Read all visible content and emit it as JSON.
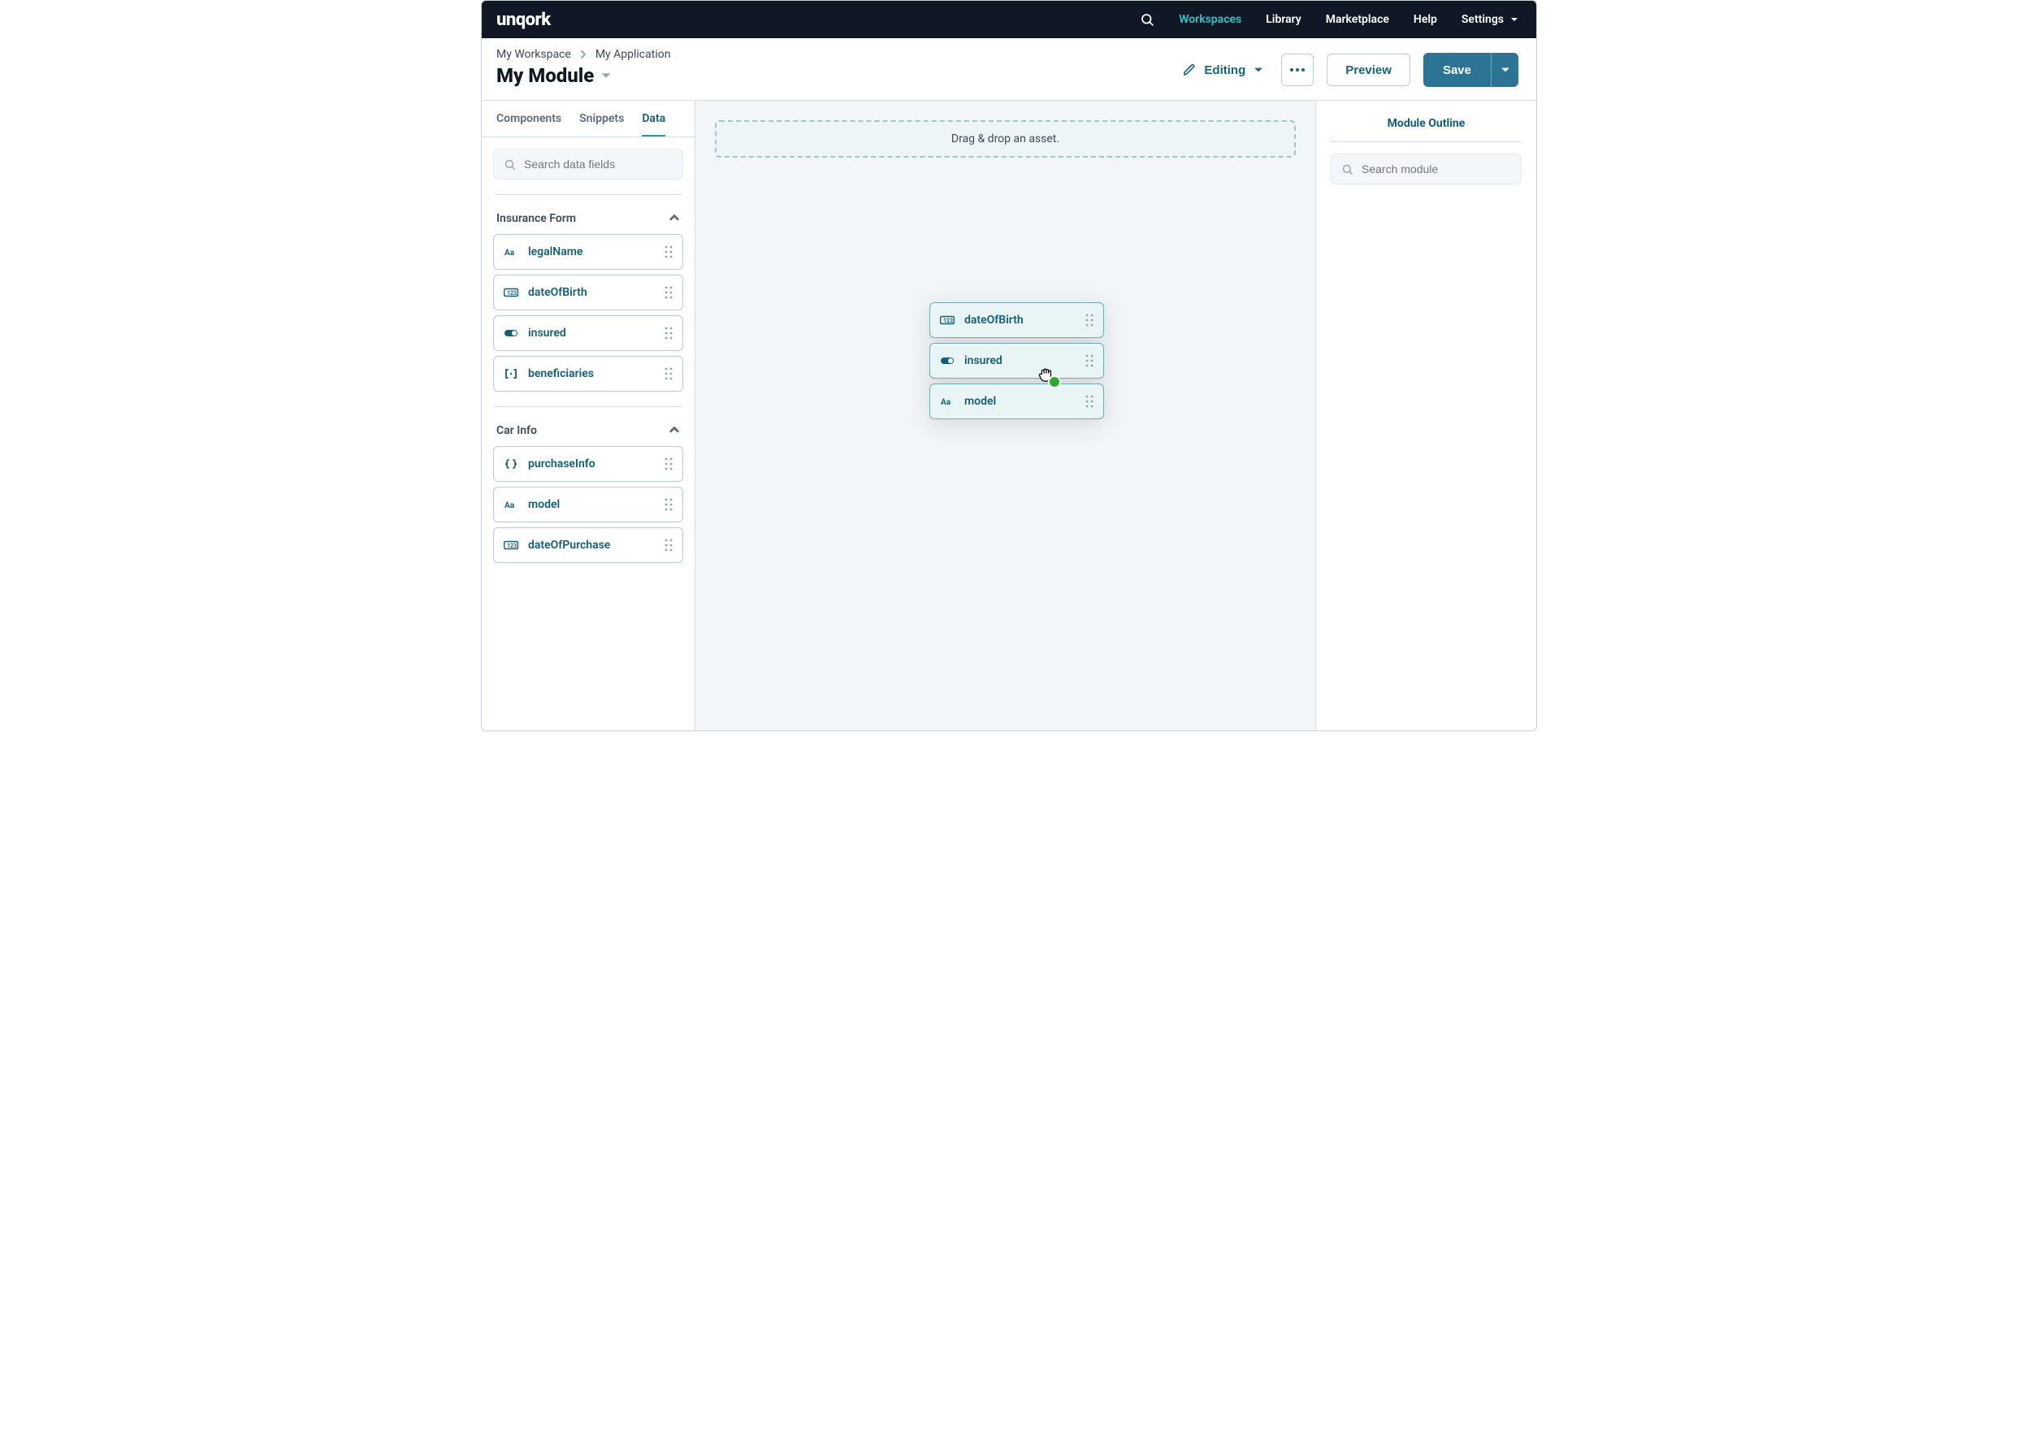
{
  "brand": "unqork",
  "nav": {
    "workspaces": "Workspaces",
    "library": "Library",
    "marketplace": "Marketplace",
    "help": "Help",
    "settings": "Settings"
  },
  "breadcrumb": {
    "workspace": "My Workspace",
    "application": "My Application"
  },
  "pageTitle": "My Module",
  "actions": {
    "editing": "Editing",
    "preview": "Preview",
    "save": "Save"
  },
  "leftTabs": {
    "components": "Components",
    "snippets": "Snippets",
    "data": "Data"
  },
  "leftSearchPlaceholder": "Search data fields",
  "groups": [
    {
      "title": "Insurance Form",
      "items": [
        {
          "type": "text",
          "label": "legalName"
        },
        {
          "type": "number",
          "label": "dateOfBirth"
        },
        {
          "type": "toggle",
          "label": "insured"
        },
        {
          "type": "array",
          "label": "beneficiaries"
        }
      ]
    },
    {
      "title": "Car Info",
      "items": [
        {
          "type": "object",
          "label": "purchaseInfo"
        },
        {
          "type": "text",
          "label": "model"
        },
        {
          "type": "number",
          "label": "dateOfPurchase"
        }
      ]
    }
  ],
  "dropzoneText": "Drag & drop an asset.",
  "dragStack": [
    {
      "type": "number",
      "label": "dateOfBirth"
    },
    {
      "type": "toggle",
      "label": "insured"
    },
    {
      "type": "text",
      "label": "model"
    }
  ],
  "outlineTitle": "Module Outline",
  "outlineSearchPlaceholder": "Search module"
}
